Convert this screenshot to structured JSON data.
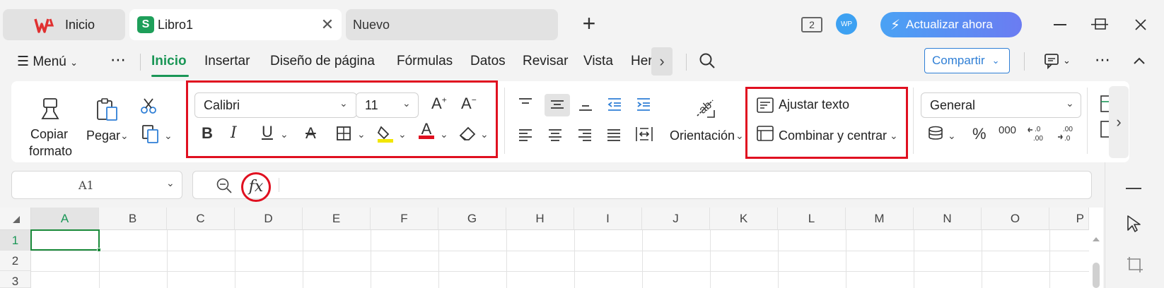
{
  "tabs": {
    "home": "Inicio",
    "active": "Libro1",
    "new": "Nuevo",
    "new_tab_glyph": "+",
    "close_glyph": "✕"
  },
  "titlebar": {
    "window_count": "2",
    "avatar": "WP",
    "upgrade_label": "Actualizar ahora"
  },
  "menu": {
    "menu_label": "Menú",
    "more": "⋯",
    "items": [
      "Inicio",
      "Insertar",
      "Diseño de página",
      "Fórmulas",
      "Datos",
      "Revisar",
      "Vista",
      "Her"
    ],
    "share_label": "Compartir"
  },
  "ribbon": {
    "copy_format_line1": "Copiar",
    "copy_format_line2": "formato",
    "paste": "Pegar",
    "font_name": "Calibri",
    "font_size": "11",
    "orientation": "Orientación",
    "wrap_text": "Ajustar texto",
    "merge_center": "Combinar y centrar",
    "number_format": "General",
    "percent": "%",
    "thousands": "000"
  },
  "formula_bar": {
    "cell_ref": "A1",
    "fx": "fx"
  },
  "grid": {
    "columns": [
      "A",
      "B",
      "C",
      "D",
      "E",
      "F",
      "G",
      "H",
      "I",
      "J",
      "K",
      "L",
      "M",
      "N",
      "O",
      "P"
    ],
    "rows": [
      "1",
      "2",
      "3"
    ]
  },
  "colors": {
    "accent_green": "#1a9656",
    "highlight_red": "#e01020",
    "share_blue": "#2f7fd6"
  }
}
